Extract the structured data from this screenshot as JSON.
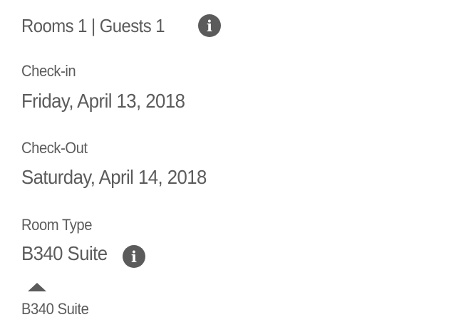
{
  "booking": {
    "rooms_guests": "Rooms 1 | Guests 1",
    "checkin": {
      "label": "Check-in",
      "value": "Friday, April 13, 2018"
    },
    "checkout": {
      "label": "Check-Out",
      "value": "Saturday, April 14, 2018"
    },
    "room_type": {
      "label": "Room Type",
      "value": "B340 Suite",
      "dropdown_option": "B340 Suite"
    },
    "info_icon_glyph": "i"
  },
  "colors": {
    "text": "#5b5b5b",
    "background": "#ffffff"
  },
  "icons": [
    "info-icon",
    "caret-up-icon"
  ]
}
